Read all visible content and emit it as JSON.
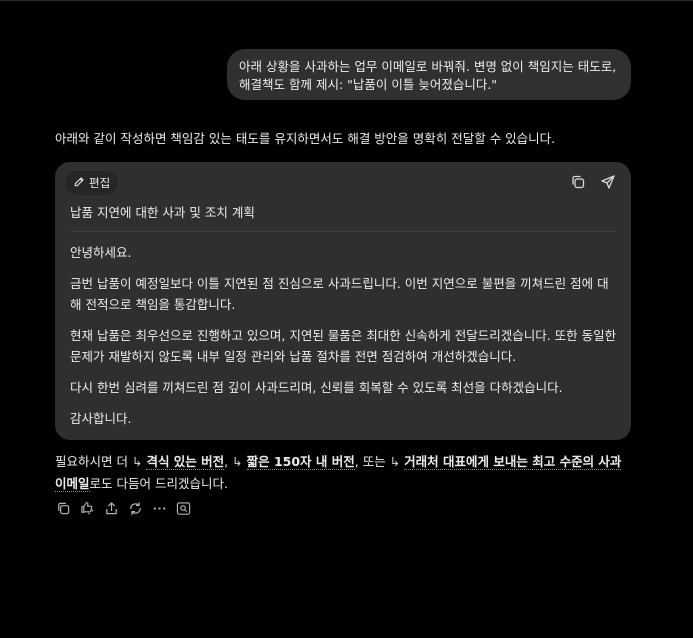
{
  "conversation": {
    "user_message": "아래 상황을 사과하는 업무 이메일로 바꿔줘. 변명 없이 책임지는 태도로, 해결책도 함께 제시: \"납품이 이틀 늦어졌습니다.\"",
    "assistant_intro": "아래와 같이 작성하면 책임감 있는 태도를 유지하면서도 해결 방안을 명확히 전달할 수 있습니다."
  },
  "email_card": {
    "edit_label": "편집",
    "subject": "납품 지연에 대한 사과 및 조치 계획",
    "paragraphs": [
      "안녕하세요.",
      "금번 납품이 예정일보다 이틀 지연된 점 진심으로 사과드립니다. 이번 지연으로 불편을 끼쳐드린 점에 대해 전적으로 책임을 통감합니다.",
      "현재 납품은 최우선으로 진행하고 있으며, 지연된 물품은 최대한 신속하게 전달드리겠습니다. 또한 동일한 문제가 재발하지 않도록 내부 일정 관리와 납품 절차를 전면 점검하여 개선하겠습니다.",
      "다시 한번 심려를 끼쳐드린 점 깊이 사과드리며, 신뢰를 회복할 수 있도록 최선을 다하겠습니다.",
      "감사합니다."
    ]
  },
  "followup": {
    "prefix": "필요하시면 더",
    "arrow": "↳",
    "link1": "격식 있는 버전",
    "sep1": ",",
    "link2": "짧은 150자 내 버전",
    "sep2": ", 또는",
    "link3": "거래처 대표에게 보내는 최고 수준의 사과 이메일",
    "suffix": "로도 다듬어 드리겠습니다."
  },
  "icons": {
    "edit": "pencil-icon",
    "card_copy": "copy-icon",
    "card_send": "send-icon",
    "actions": [
      "copy-icon",
      "thumbs-icon",
      "share-icon",
      "regenerate-icon",
      "more-icon",
      "search-icon"
    ]
  },
  "colors": {
    "background": "#000000",
    "bubble": "#303030",
    "card": "#2f2f2f",
    "text": "#ececec"
  }
}
